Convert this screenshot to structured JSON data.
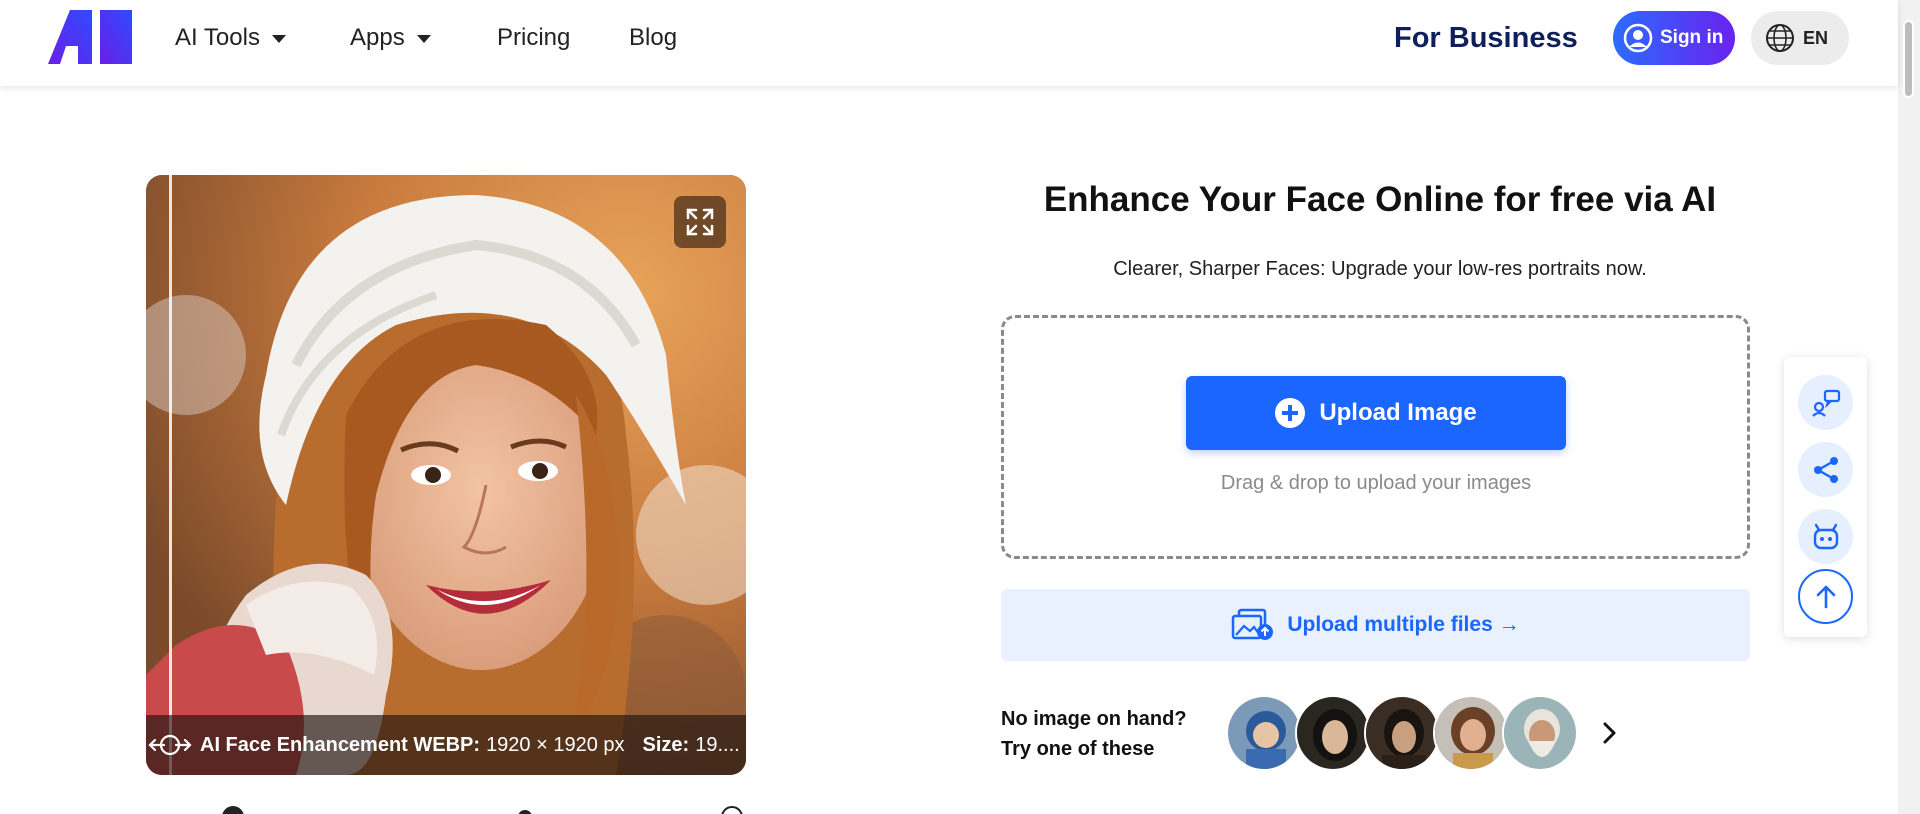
{
  "header": {
    "nav": [
      {
        "label": "AI Tools",
        "dropdown": true
      },
      {
        "label": "Apps",
        "dropdown": true
      },
      {
        "label": "Pricing",
        "dropdown": false
      },
      {
        "label": "Blog",
        "dropdown": false
      }
    ],
    "for_business": "For Business",
    "signin_label": "Sign in",
    "language": "EN"
  },
  "preview": {
    "caption_name": "AI Face Enhancement WEBP:",
    "caption_dims": "1920 × 1920 px",
    "caption_size_label": "Size:",
    "caption_size_value": "19...."
  },
  "main": {
    "title": "Enhance Your Face Online for free via AI",
    "subtitle": "Clearer, Sharper Faces: Upgrade your low-res portraits now.",
    "upload_label": "Upload Image",
    "drag_text": "Drag & drop to upload your images",
    "multi_label": "Upload multiple files →",
    "try_line1": "No image on hand?",
    "try_line2": "Try one of these"
  },
  "colors": {
    "accent": "#1a66ff",
    "brand_dark": "#0f1f5c",
    "signin_gradient_start": "#2b6cff",
    "signin_gradient_end": "#6a22f0"
  },
  "icons": {
    "floating": [
      "feedback-icon",
      "share-icon",
      "bot-icon",
      "back-to-top-icon"
    ]
  }
}
